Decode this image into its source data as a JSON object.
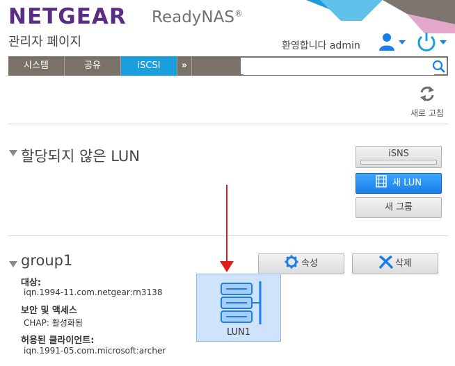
{
  "header": {
    "brand": "NETGEAR",
    "product": "ReadyNAS",
    "product_mark": "®",
    "subtitle": "관리자 페이지",
    "welcome": "환영합니다 admin"
  },
  "nav": {
    "tabs": [
      {
        "label": "시스템"
      },
      {
        "label": "공유"
      },
      {
        "label": "iSCSI"
      },
      {
        "label": "»"
      }
    ],
    "active_index": 2,
    "search_value": ""
  },
  "refresh": {
    "label": "새로 고침"
  },
  "unassigned": {
    "title": "할당되지 않은 LUN",
    "buttons": {
      "isns": "iSNS",
      "new_lun": "새 LUN",
      "new_group": "새 그룹"
    }
  },
  "group": {
    "title": "group1",
    "buttons": {
      "properties": "속성",
      "delete": "삭제"
    },
    "target_label": "대상:",
    "target_value": "iqn.1994-11.com.netgear:rn3138",
    "security_label": "보안 및 액세스",
    "security_value": "CHAP: 활성화됨",
    "clients_label": "허용된 클라이언트:",
    "clients_value": "iqn.1991-05.com.microsoft:archer",
    "lun": {
      "label": "LUN1"
    }
  },
  "colors": {
    "brand": "#5b2c83",
    "nav_bg": "#7a7268",
    "accent": "#1a9fdc",
    "primary_button": "#1a7ee8",
    "annotation_arrow": "#e01b1b"
  }
}
